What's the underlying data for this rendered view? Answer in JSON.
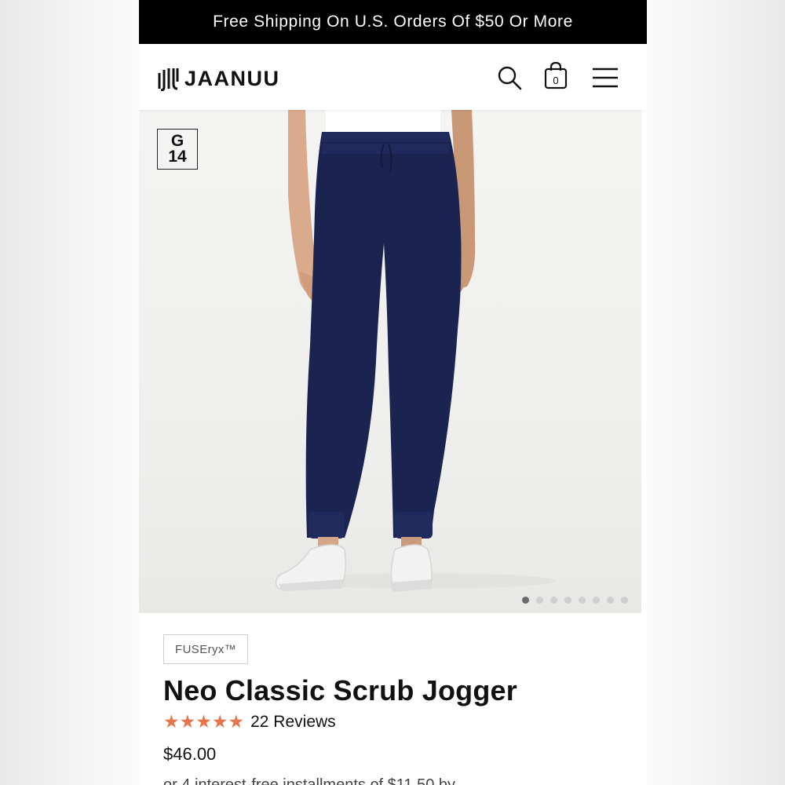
{
  "promo_banner": {
    "text": "Free Shipping On U.S. Orders Of $50 Or More"
  },
  "header": {
    "brand": "JAANUU",
    "cart_count": "0",
    "icons": [
      "search-icon",
      "shopping-bag-icon",
      "hamburger-menu-icon"
    ]
  },
  "gallery": {
    "badge_line1": "G",
    "badge_line2": "14",
    "slide_count": 8,
    "active_slide": 1,
    "pants_color": "#1b2350"
  },
  "product": {
    "fabric_tag": "FUSEryx™",
    "title": "Neo Classic Scrub Jogger",
    "stars": "★★★★★",
    "star_color": "#e8744a",
    "rating_value": 5,
    "reviews": "22 Reviews",
    "price": "$46.00",
    "installments": "or 4 interest-free installments of $11.50 by"
  }
}
